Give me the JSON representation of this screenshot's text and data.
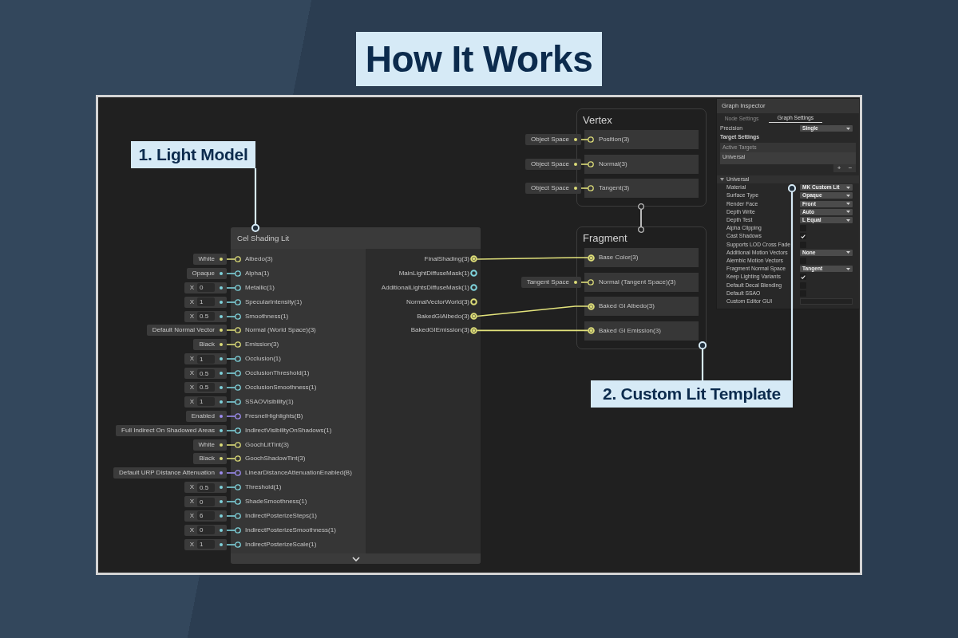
{
  "title": "How It Works",
  "annotations": [
    {
      "text": "1. Light Model"
    },
    {
      "text": "2. Custom Lit Template"
    }
  ],
  "shader_node": {
    "title": "Cel Shading Lit",
    "inputs": [
      {
        "label": "Albedo(3)",
        "kind": "text",
        "value": "White",
        "color": "#dcdc78"
      },
      {
        "label": "Alpha(1)",
        "kind": "text",
        "value": "Opaque",
        "color": "#7fd3dc"
      },
      {
        "label": "Metallic(1)",
        "kind": "vector1",
        "axis": "X",
        "value": "0",
        "color": "#7fd3dc"
      },
      {
        "label": "SpecularIntensity(1)",
        "kind": "vector1",
        "axis": "X",
        "value": "1",
        "color": "#7fd3dc"
      },
      {
        "label": "Smoothness(1)",
        "kind": "vector1",
        "axis": "X",
        "value": "0.5",
        "color": "#7fd3dc"
      },
      {
        "label": "Normal (World Space)(3)",
        "kind": "text",
        "value": "Default Normal Vector",
        "color": "#dcdc78"
      },
      {
        "label": "Emission(3)",
        "kind": "text",
        "value": "Black",
        "color": "#dcdc78"
      },
      {
        "label": "Occlusion(1)",
        "kind": "vector1",
        "axis": "X",
        "value": "1",
        "color": "#7fd3dc"
      },
      {
        "label": "OcclusionThreshold(1)",
        "kind": "vector1",
        "axis": "X",
        "value": "0.5",
        "color": "#7fd3dc"
      },
      {
        "label": "OcclusionSmoothness(1)",
        "kind": "vector1",
        "axis": "X",
        "value": "0.5",
        "color": "#7fd3dc"
      },
      {
        "label": "SSAOVisibility(1)",
        "kind": "vector1",
        "axis": "X",
        "value": "1",
        "color": "#7fd3dc"
      },
      {
        "label": "FresnelHighlights(B)",
        "kind": "text",
        "value": "Enabled",
        "color": "#9d8cf0"
      },
      {
        "label": "IndirectVisibilityOnShadows(1)",
        "kind": "text",
        "value": "Full Indirect On Shadowed Areas",
        "color": "#7fd3dc"
      },
      {
        "label": "GoochLitTint(3)",
        "kind": "text",
        "value": "White",
        "color": "#dcdc78"
      },
      {
        "label": "GoochShadowTint(3)",
        "kind": "text",
        "value": "Black",
        "color": "#dcdc78"
      },
      {
        "label": "LinearDistanceAttenuationEnabled(B)",
        "kind": "text",
        "value": "Default URP Distance Attenuation",
        "color": "#9d8cf0"
      },
      {
        "label": "Threshold(1)",
        "kind": "vector1",
        "axis": "X",
        "value": "0.5",
        "color": "#7fd3dc"
      },
      {
        "label": "ShadeSmoothness(1)",
        "kind": "vector1",
        "axis": "X",
        "value": "0",
        "color": "#7fd3dc"
      },
      {
        "label": "IndirectPosterizeSteps(1)",
        "kind": "vector1",
        "axis": "X",
        "value": "6",
        "color": "#7fd3dc"
      },
      {
        "label": "IndirectPosterizeSmoothness(1)",
        "kind": "vector1",
        "axis": "X",
        "value": "0",
        "color": "#7fd3dc"
      },
      {
        "label": "IndirectPosterizeScale(1)",
        "kind": "vector1",
        "axis": "X",
        "value": "1",
        "color": "#7fd3dc"
      }
    ],
    "outputs": [
      {
        "label": "FinalShading(3)",
        "color": "#dcdc78",
        "connected": true
      },
      {
        "label": "MainLightDiffuseMask(1)",
        "color": "#7fd3dc",
        "connected": false
      },
      {
        "label": "AdditionalLightsDiffuseMask(1)",
        "color": "#7fd3dc",
        "connected": false
      },
      {
        "label": "NormalVectorWorld(3)",
        "color": "#dcdc78",
        "connected": false
      },
      {
        "label": "BakedGIAlbedo(3)",
        "color": "#dcdc78",
        "connected": true
      },
      {
        "label": "BakedGIEmission(3)",
        "color": "#dcdc78",
        "connected": true
      }
    ]
  },
  "vertex_block": {
    "title": "Vertex",
    "ports": [
      {
        "label": "Position(3)",
        "input": "Object Space",
        "connected": false
      },
      {
        "label": "Normal(3)",
        "input": "Object Space",
        "connected": false
      },
      {
        "label": "Tangent(3)",
        "input": "Object Space",
        "connected": false
      }
    ]
  },
  "fragment_block": {
    "title": "Fragment",
    "ports": [
      {
        "label": "Base Color(3)",
        "connected": true
      },
      {
        "label": "Normal (Tangent Space)(3)",
        "input": "Tangent Space",
        "connected": false
      },
      {
        "label": "Baked GI Albedo(3)",
        "connected": true
      },
      {
        "label": "Baked GI Emission(3)",
        "connected": true
      }
    ]
  },
  "inspector": {
    "title": "Graph Inspector",
    "tabs": [
      {
        "label": "Node Settings",
        "selected": false
      },
      {
        "label": "Graph Settings",
        "selected": true
      }
    ],
    "precision": {
      "label": "Precision",
      "value": "Single"
    },
    "section": "Target Settings",
    "targets": {
      "header": "Active Targets",
      "items": [
        "Universal"
      ],
      "add": "+",
      "remove": "−"
    },
    "foldout": {
      "label": "Universal",
      "expanded": true
    },
    "properties": [
      {
        "label": "Material",
        "kind": "dropdown",
        "value": "MK Custom Lit"
      },
      {
        "label": "Surface Type",
        "kind": "dropdown",
        "value": "Opaque"
      },
      {
        "label": "Render Face",
        "kind": "dropdown",
        "value": "Front"
      },
      {
        "label": "Depth Write",
        "kind": "dropdown",
        "value": "Auto"
      },
      {
        "label": "Depth Test",
        "kind": "dropdown",
        "value": "L Equal"
      },
      {
        "label": "Alpha Clipping",
        "kind": "checkbox",
        "checked": false
      },
      {
        "label": "Cast Shadows",
        "kind": "checkbox",
        "checked": true
      },
      {
        "label": "Supports LOD Cross Fade",
        "kind": "checkbox",
        "checked": false
      },
      {
        "label": "Additional Motion Vectors",
        "kind": "dropdown",
        "value": "None"
      },
      {
        "label": "Alembic Motion Vectors",
        "kind": "checkbox",
        "checked": false
      },
      {
        "label": "Fragment Normal Space",
        "kind": "dropdown",
        "value": "Tangent"
      },
      {
        "label": "Keep Lighting Variants",
        "kind": "checkbox",
        "checked": true
      },
      {
        "label": "Default Decal Blending",
        "kind": "checkbox",
        "checked": false
      },
      {
        "label": "Default SSAO",
        "kind": "checkbox",
        "checked": false
      },
      {
        "label": "Custom Editor GUI",
        "kind": "text"
      }
    ]
  }
}
